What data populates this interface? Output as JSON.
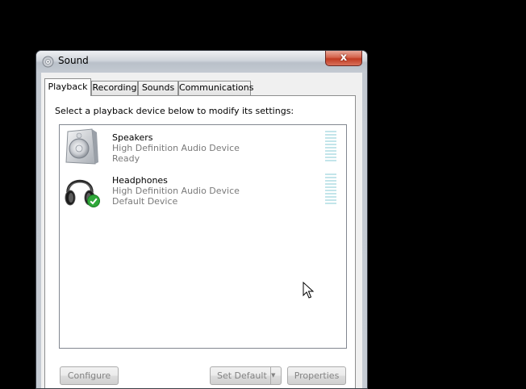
{
  "window": {
    "title": "Sound",
    "close_label": "x"
  },
  "tabs": [
    {
      "label": "Playback",
      "active": true
    },
    {
      "label": "Recording",
      "active": false
    },
    {
      "label": "Sounds",
      "active": false
    },
    {
      "label": "Communications",
      "active": false
    }
  ],
  "playback": {
    "instruction": "Select a playback device below to modify its settings:",
    "devices": [
      {
        "name": "Speakers",
        "description": "High Definition Audio Device",
        "status": "Ready",
        "icon": "speaker-icon"
      },
      {
        "name": "Headphones",
        "description": "High Definition Audio Device",
        "status": "Default Device",
        "icon": "headphones-icon",
        "badge": "default-check-icon"
      }
    ]
  },
  "buttons": {
    "configure": "Configure",
    "set_default": "Set Default",
    "properties": "Properties"
  },
  "colors": {
    "close_button": "#c13b22",
    "meter": "#c3e5ea",
    "default_check": "#2fa83a"
  }
}
